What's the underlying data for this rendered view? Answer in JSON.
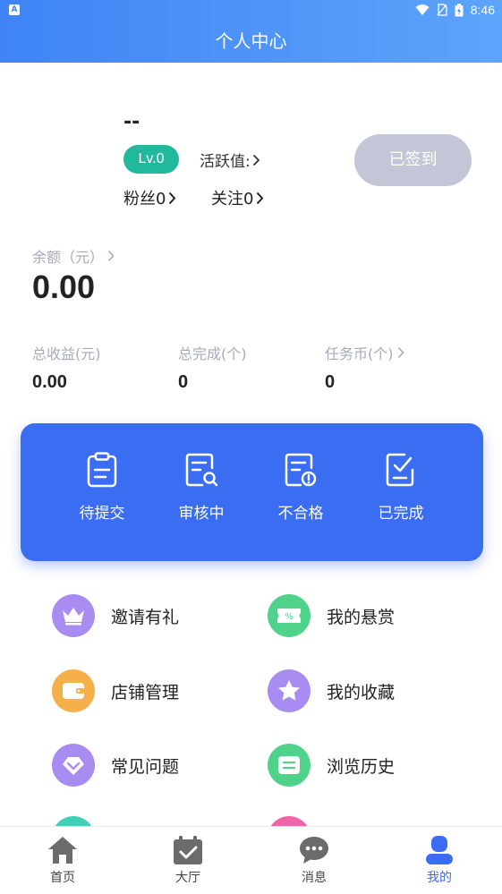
{
  "status_bar": {
    "time": "8:46",
    "app_icon_letter": "A"
  },
  "header": {
    "title": "个人中心"
  },
  "profile": {
    "name": "--",
    "level": "Lv.0",
    "activity_label": "活跃值:",
    "fans_label": "粉丝0",
    "follow_label": "关注0",
    "sign_button": "已签到"
  },
  "balance": {
    "label": "余额（元）",
    "value": "0.00"
  },
  "stats": [
    {
      "label": "总收益(元)",
      "value": "0.00"
    },
    {
      "label": "总完成(个)",
      "value": "0"
    },
    {
      "label": "任务币(个)",
      "value": "0"
    }
  ],
  "tasks": [
    {
      "label": "待提交",
      "icon": "clipboard-icon"
    },
    {
      "label": "审核中",
      "icon": "document-search-icon"
    },
    {
      "label": "不合格",
      "icon": "document-warning-icon"
    },
    {
      "label": "已完成",
      "icon": "document-check-icon"
    }
  ],
  "menu": [
    {
      "label": "邀请有礼",
      "icon": "crown-icon",
      "color": "#a98cf2"
    },
    {
      "label": "我的悬赏",
      "icon": "ticket-icon",
      "color": "#4fd38a"
    },
    {
      "label": "店铺管理",
      "icon": "wallet-icon",
      "color": "#f5b04b"
    },
    {
      "label": "我的收藏",
      "icon": "star-icon",
      "color": "#a98cf2"
    },
    {
      "label": "常见问题",
      "icon": "heart-icon",
      "color": "#a98cf2"
    },
    {
      "label": "浏览历史",
      "icon": "list-icon",
      "color": "#4fd38a"
    }
  ],
  "tabbar": [
    {
      "label": "首页",
      "icon": "home-icon"
    },
    {
      "label": "大厅",
      "icon": "calendar-check-icon"
    },
    {
      "label": "消息",
      "icon": "chat-icon"
    },
    {
      "label": "我的",
      "icon": "user-icon"
    }
  ],
  "colors": {
    "primary": "#3a6df2",
    "header_start": "#3f84f6",
    "header_end": "#5da4fb",
    "level_badge": "#22b89c",
    "signed_button": "#c3c6d6"
  }
}
